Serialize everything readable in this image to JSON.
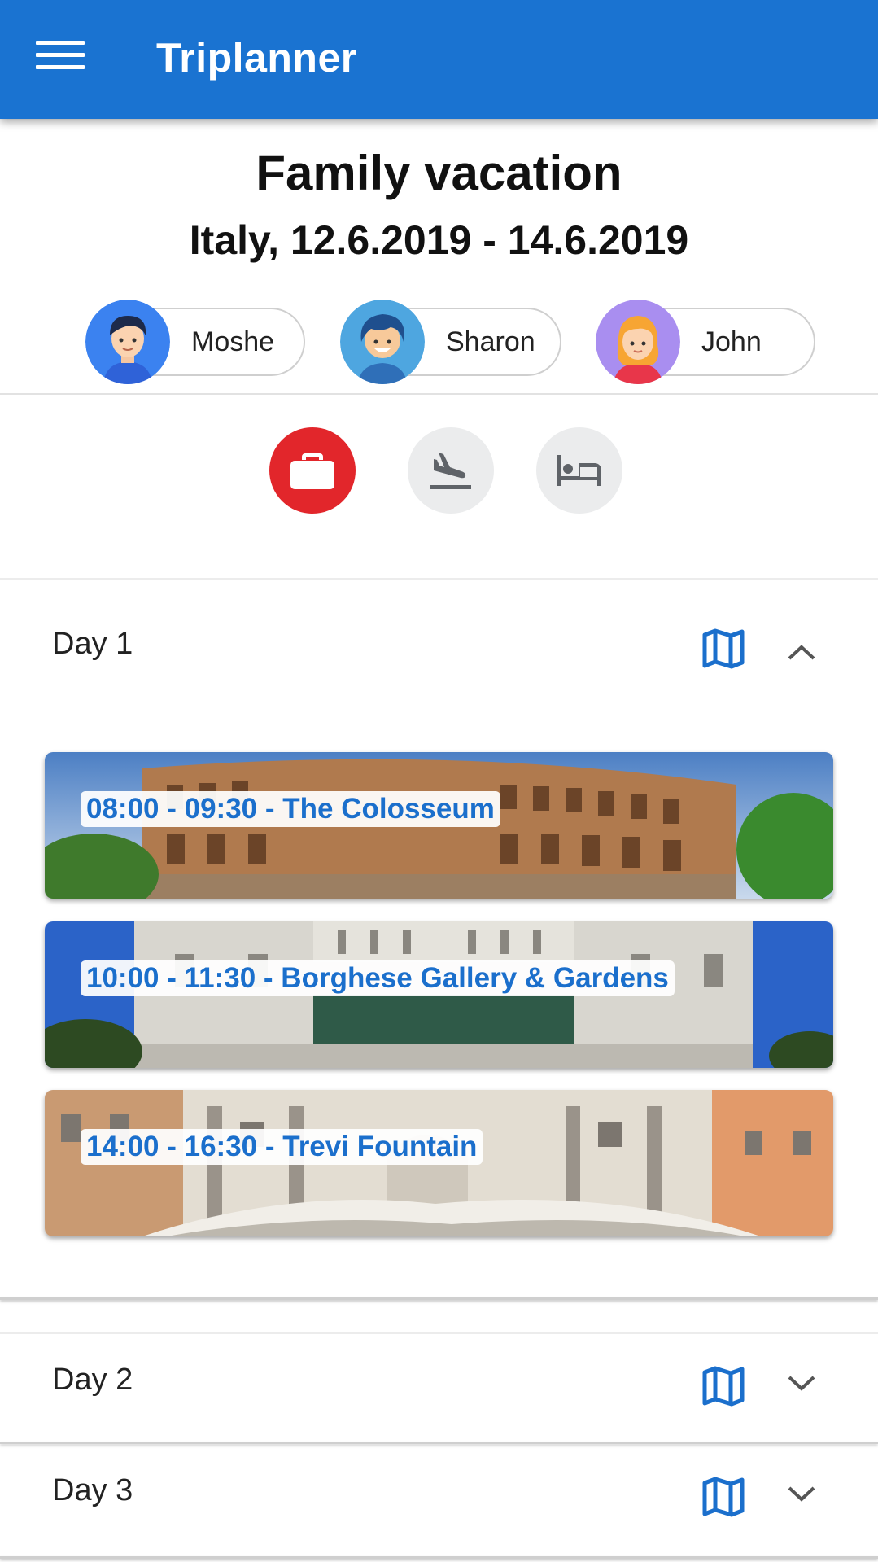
{
  "app": {
    "title": "Triplanner"
  },
  "trip": {
    "title": "Family vacation",
    "subtitle": "Italy, 12.6.2019 - 14.6.2019"
  },
  "travelers": [
    {
      "name": "Moshe",
      "avatar_color": "#3b82f0"
    },
    {
      "name": "Sharon",
      "avatar_color": "#4ea6e0"
    },
    {
      "name": "John",
      "avatar_color": "#a98ef0"
    }
  ],
  "categories": [
    {
      "name": "briefcase-icon",
      "active": true
    },
    {
      "name": "flight-landing-icon",
      "active": false
    },
    {
      "name": "hotel-bed-icon",
      "active": false
    }
  ],
  "days": [
    {
      "label": "Day 1",
      "expanded": true,
      "activities": [
        {
          "label": "08:00 - 09:30 - The Colosseum"
        },
        {
          "label": "10:00 - 11:30 - Borghese Gallery & Gardens"
        },
        {
          "label": "14:00 - 16:30 - Trevi Fountain"
        }
      ]
    },
    {
      "label": "Day 2",
      "expanded": false
    },
    {
      "label": "Day 3",
      "expanded": false
    }
  ],
  "colors": {
    "primary": "#1a73d1",
    "accent_red": "#e2262b",
    "link_blue": "#1b6fcc"
  }
}
